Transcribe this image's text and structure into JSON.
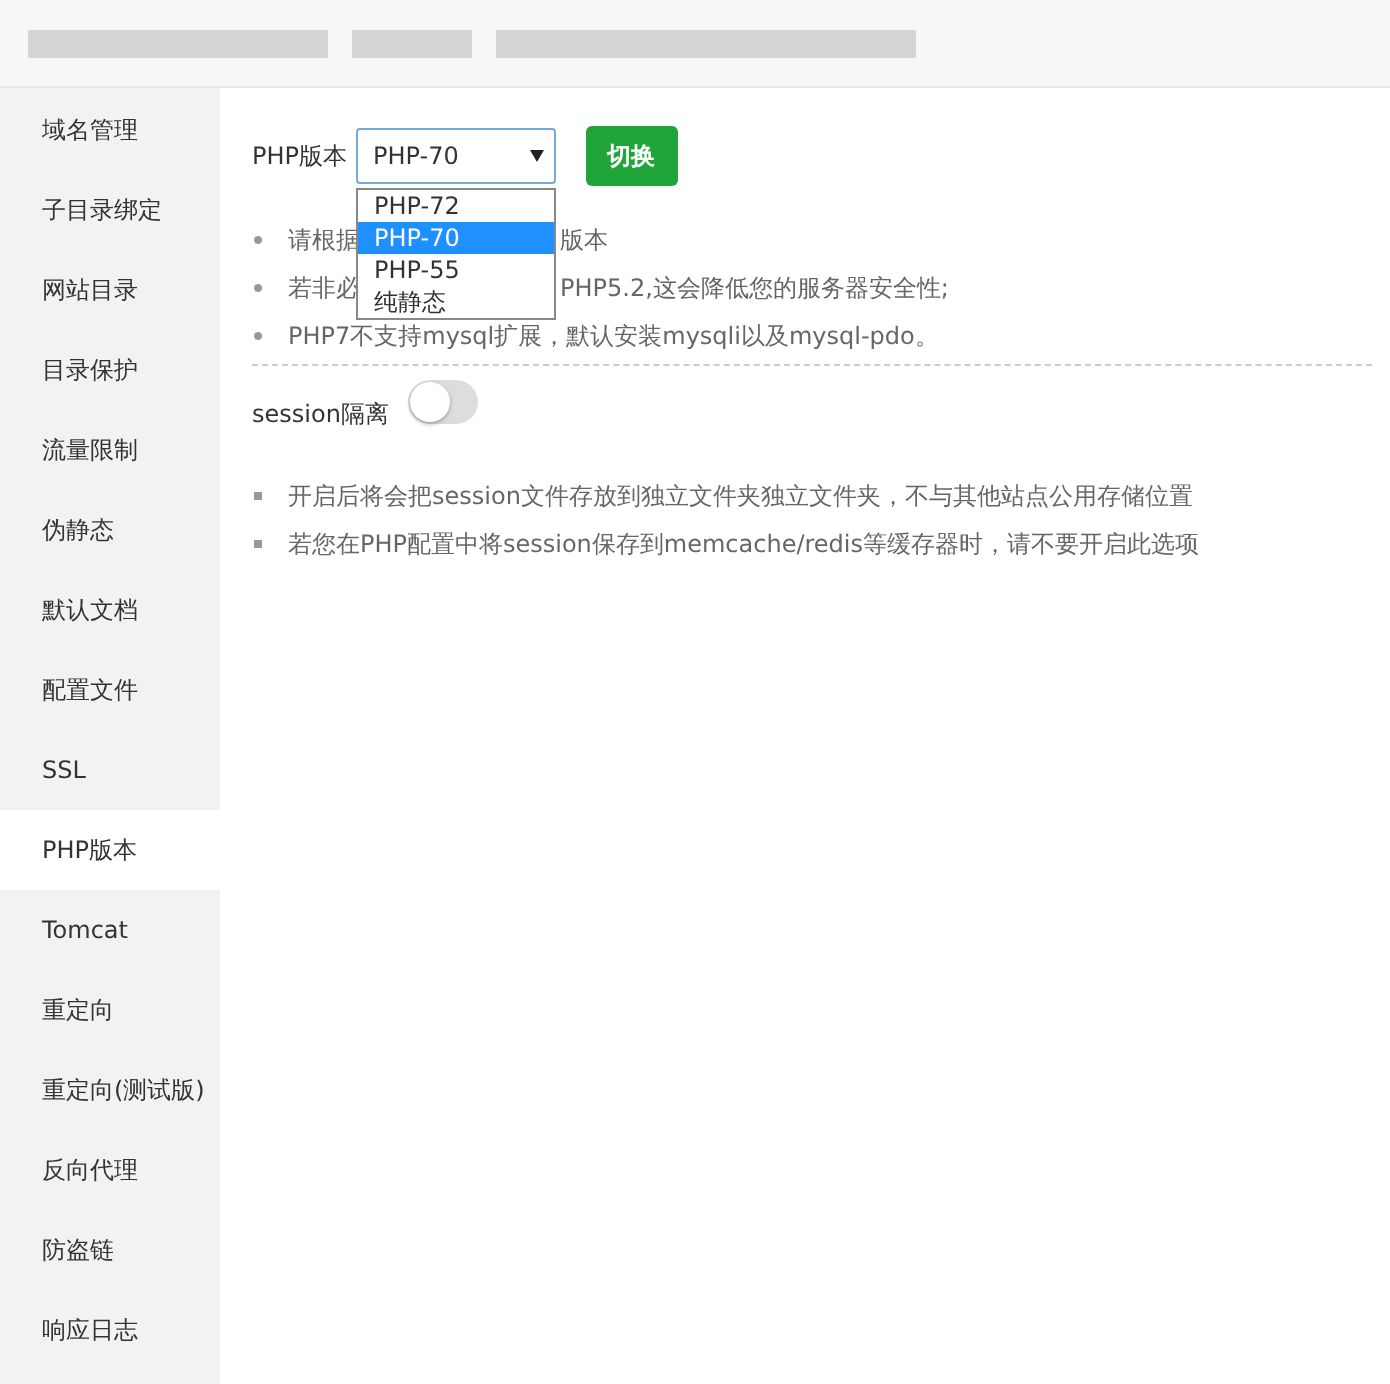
{
  "sidebar": {
    "items": [
      {
        "label": "域名管理",
        "selected": false
      },
      {
        "label": "子目录绑定",
        "selected": false
      },
      {
        "label": "网站目录",
        "selected": false
      },
      {
        "label": "目录保护",
        "selected": false
      },
      {
        "label": "流量限制",
        "selected": false
      },
      {
        "label": "伪静态",
        "selected": false
      },
      {
        "label": "默认文档",
        "selected": false
      },
      {
        "label": "配置文件",
        "selected": false
      },
      {
        "label": "SSL",
        "selected": false
      },
      {
        "label": "PHP版本",
        "selected": true
      },
      {
        "label": "Tomcat",
        "selected": false
      },
      {
        "label": "重定向",
        "selected": false
      },
      {
        "label": "重定向(测试版)",
        "selected": false
      },
      {
        "label": "反向代理",
        "selected": false
      },
      {
        "label": "防盗链",
        "selected": false
      },
      {
        "label": "响应日志",
        "selected": false
      }
    ]
  },
  "php": {
    "label": "PHP版本",
    "value": "PHP-70",
    "button": "切换",
    "options": [
      {
        "label": "PHP-72",
        "selected": false
      },
      {
        "label": "PHP-70",
        "selected": true
      },
      {
        "label": "PHP-55",
        "selected": false
      },
      {
        "label": "纯静态",
        "selected": false
      }
    ],
    "tips": [
      {
        "before": "请根据",
        "after": "版本"
      },
      {
        "before": "若非必",
        "after": "PHP5.2,这会降低您的服务器安全性;"
      },
      {
        "before": "PHP7不支持mysql扩展，默认安装mysqli以及mysql-pdo。"
      }
    ]
  },
  "session": {
    "label": "session隔离",
    "on": false,
    "tips": [
      "开启后将会把session文件存放到独立文件夹独立文件夹，不与其他站点公用存储位置",
      "若您在PHP配置中将session保存到memcache/redis等缓存器时，请不要开启此选项"
    ]
  }
}
